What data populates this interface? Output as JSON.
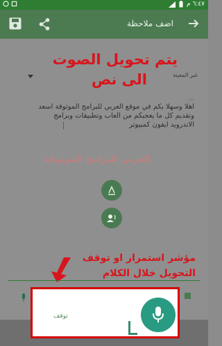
{
  "status_bar": {
    "time": "٦:٤٧ م"
  },
  "app_bar": {
    "title": "اضف ملاحظة"
  },
  "overlays": {
    "headline_line1": "يتم تحويل الصوت",
    "headline_line2": "الى نص",
    "indicator_line1": "مؤشر استمرار او توقف",
    "indicator_line2": "التحويل خلال الكلام"
  },
  "form": {
    "language": "غير المعينة",
    "note_label": "نص",
    "note_text": "اهلا وسهلا بكم في موقع العربي للبرامج الموثوقة اسعد وتقديم كل ما يعجبكم من العاب وتطبيقات وبرامج الاندرويد ايفون كمبيوتر",
    "watermark": "العربي للبرامج الموثوقة"
  },
  "voice_dialog": {
    "stop_label": "توقف"
  },
  "colors": {
    "primary": "#4c7a51",
    "accent": "#2a9b83",
    "annotation": "#d8151c"
  }
}
